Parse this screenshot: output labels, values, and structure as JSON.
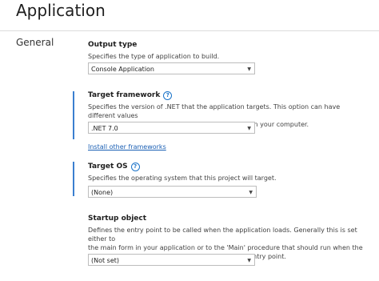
{
  "page": {
    "title": "Application"
  },
  "sidebar": {
    "section": "General"
  },
  "output_type": {
    "heading": "Output type",
    "description": "Specifies the type of application to build.",
    "value": "Console Application"
  },
  "target_framework": {
    "heading": "Target framework",
    "description_line1": "Specifies the version of .NET that the application targets. This option can have different values",
    "description_line2": "depending on which versions of .NET are installed on your computer.",
    "value": ".NET 7.0",
    "install_link": "Install other frameworks"
  },
  "target_os": {
    "heading": "Target OS",
    "description": "Specifies the operating system that this project will target.",
    "value": "(None)"
  },
  "startup_object": {
    "heading": "Startup object",
    "description_line1": "Defines the entry point to be called when the application loads. Generally this is set either to",
    "description_line2": "the main form in your application or to the 'Main' procedure that should run when the",
    "description_line3": "application starts. Class libraries do not define an entry point.",
    "value": "(Not set)"
  },
  "icons": {
    "help": "help-circle-icon",
    "dropdown": "chevron-down-icon"
  },
  "colors": {
    "accent": "#3a7fd0",
    "link": "#1a5fb4"
  }
}
